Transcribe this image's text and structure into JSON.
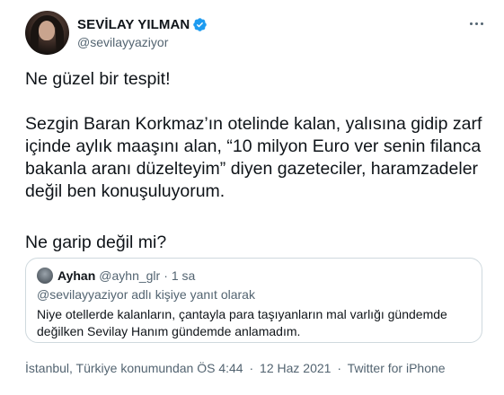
{
  "author": {
    "display_name": "SEVİLAY YILMAN",
    "handle": "@sevilayyaziyor",
    "verified": true
  },
  "tweet": {
    "paragraph_1": "Ne güzel bir tespit!",
    "paragraph_2": "Sezgin Baran Korkmaz’ın otelinde kalan, yalısına gidip zarf içinde aylık maaşını alan, “10 milyon Euro ver senin filanca bakanla aranı düzelteyim” diyen gazeteciler, haramzadeler değil ben konuşuluyorum.",
    "paragraph_3": "Ne garip değil mi?"
  },
  "quoted_tweet": {
    "display_name": "Ayhan",
    "handle": "@ayhn_glr",
    "separator": "·",
    "time": "1 sa",
    "reply_context": "@sevilayyaziyor adlı kişiye yanıt olarak",
    "text": "Niye otellerde kalanların, çantayla para taşıyanların mal varlığı gündemde değilken Sevilay Hanım gündemde anlamadım."
  },
  "meta": {
    "location": "İstanbul, Türkiye konumundan",
    "time": "ÖS 4:44",
    "separator": "·",
    "date": "12 Haz 2021",
    "source": "Twitter for iPhone"
  },
  "colors": {
    "text": "#0f1419",
    "secondary": "#536471",
    "verified_blue": "#1d9bf0",
    "border": "#cfd9de"
  }
}
